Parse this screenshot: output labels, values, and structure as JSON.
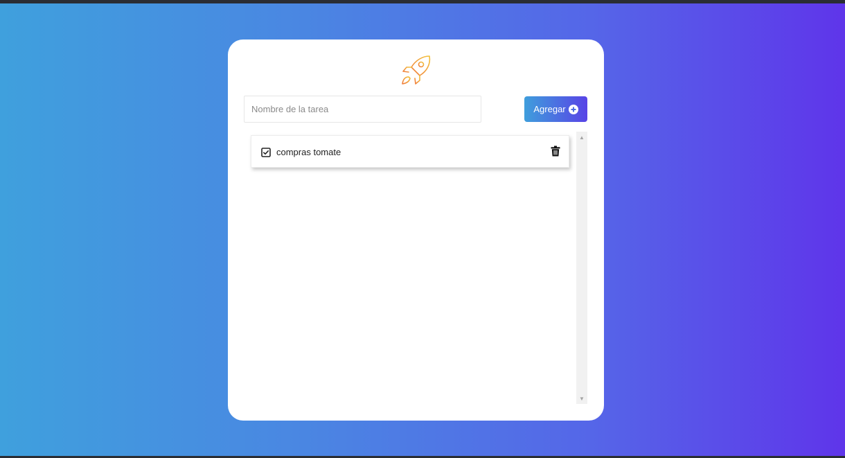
{
  "form": {
    "input_placeholder": "Nombre de la tarea",
    "input_value": "",
    "add_button_label": "Agregar"
  },
  "tasks": [
    {
      "label": "compras tomate",
      "completed": true
    }
  ],
  "icons": {
    "logo": "rocket-icon",
    "add": "plus-circle-icon",
    "check": "checkbox-checked-icon",
    "delete": "trash-icon"
  },
  "colors": {
    "accent_start": "#3f9edc",
    "accent_end": "#5844e6",
    "logo_stroke_start": "#f2c23a",
    "logo_stroke_end": "#f07a3a"
  }
}
